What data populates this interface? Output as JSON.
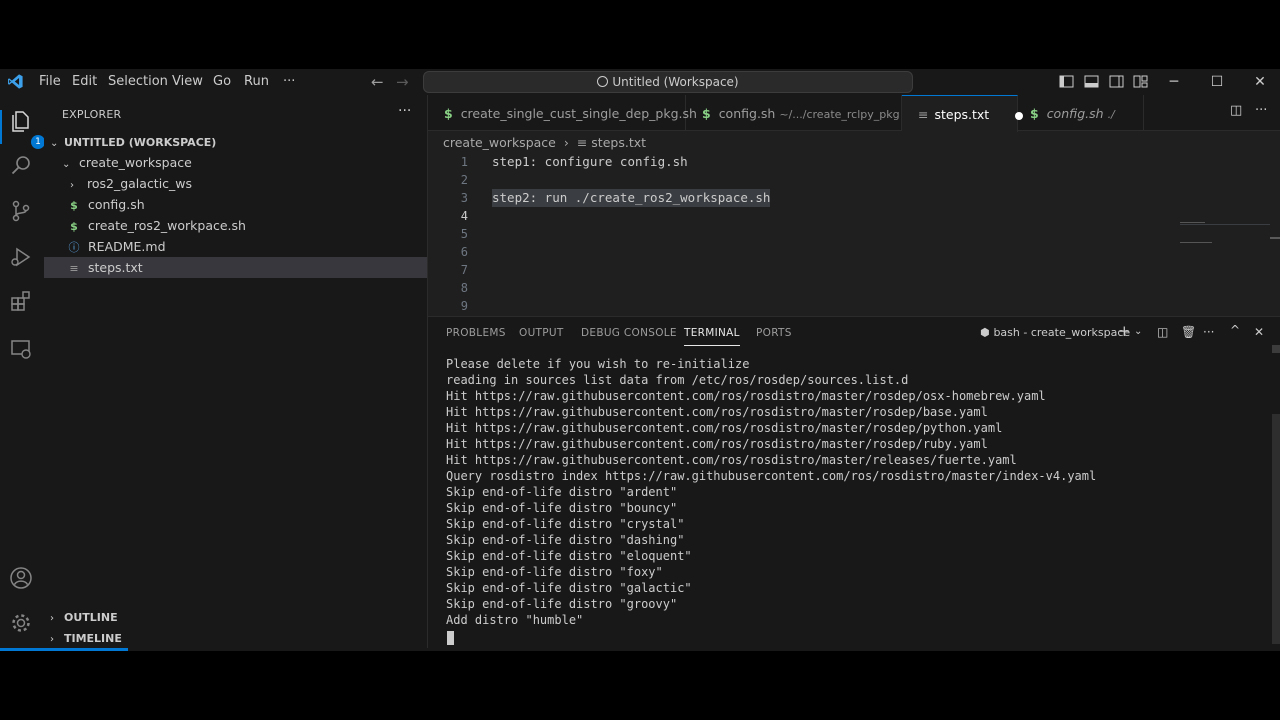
{
  "menu": [
    "File",
    "Edit",
    "Selection",
    "View",
    "Go",
    "Run",
    "···"
  ],
  "command_center": "Untitled (Workspace)",
  "window_controls": {
    "minimize": "─",
    "maximize": "☐",
    "close": "✕"
  },
  "activity": {
    "explorer_badge": "1"
  },
  "sidebar": {
    "title": "EXPLORER",
    "more": "···",
    "workspace": "UNTITLED (WORKSPACE)",
    "folder": "create_workspace",
    "items": [
      {
        "label": "ros2_galactic_ws",
        "kind": "folder"
      },
      {
        "label": "config.sh",
        "kind": "shell"
      },
      {
        "label": "create_ros2_workpace.sh",
        "kind": "shell"
      },
      {
        "label": "README.md",
        "kind": "info"
      },
      {
        "label": "steps.txt",
        "kind": "text"
      }
    ],
    "outline": "OUTLINE",
    "timeline": "TIMELINE"
  },
  "tabs": [
    {
      "label": "create_single_cust_single_dep_pkg.sh",
      "sub": ""
    },
    {
      "label": "config.sh",
      "sub": "~/.../create_rclpy_pkg"
    },
    {
      "label": "steps.txt",
      "sub": ""
    },
    {
      "label": "config.sh",
      "sub": "./"
    }
  ],
  "breadcrumb": {
    "folder": "create_workspace",
    "file": "steps.txt"
  },
  "editor": {
    "line_numbers": [
      "1",
      "2",
      "3",
      "4",
      "5",
      "6",
      "7",
      "8",
      "9"
    ],
    "lines": [
      "step1: configure config.sh",
      "",
      "step2: run ./create_ros2_workspace.sh",
      "",
      "",
      "",
      "",
      "",
      ""
    ]
  },
  "panel": {
    "tabs": [
      "PROBLEMS",
      "OUTPUT",
      "DEBUG CONSOLE",
      "TERMINAL",
      "PORTS"
    ],
    "terminal_name": "bash - create_workspace",
    "lines": [
      "Please delete if you wish to re-initialize",
      "reading in sources list data from /etc/ros/rosdep/sources.list.d",
      "Hit https://raw.githubusercontent.com/ros/rosdistro/master/rosdep/osx-homebrew.yaml",
      "Hit https://raw.githubusercontent.com/ros/rosdistro/master/rosdep/base.yaml",
      "Hit https://raw.githubusercontent.com/ros/rosdistro/master/rosdep/python.yaml",
      "Hit https://raw.githubusercontent.com/ros/rosdistro/master/rosdep/ruby.yaml",
      "Hit https://raw.githubusercontent.com/ros/rosdistro/master/releases/fuerte.yaml",
      "Query rosdistro index https://raw.githubusercontent.com/ros/rosdistro/master/index-v4.yaml",
      "Skip end-of-life distro \"ardent\"",
      "Skip end-of-life distro \"bouncy\"",
      "Skip end-of-life distro \"crystal\"",
      "Skip end-of-life distro \"dashing\"",
      "Skip end-of-life distro \"eloquent\"",
      "Skip end-of-life distro \"foxy\"",
      "Skip end-of-life distro \"galactic\"",
      "Skip end-of-life distro \"groovy\"",
      "Add distro \"humble\""
    ]
  },
  "progress": 0.1,
  "colors": {
    "accent": "#0078d4",
    "background": "#1f1f1f",
    "sidebar": "#181818",
    "shell": "#89d185",
    "info": "#5fa7e6"
  }
}
